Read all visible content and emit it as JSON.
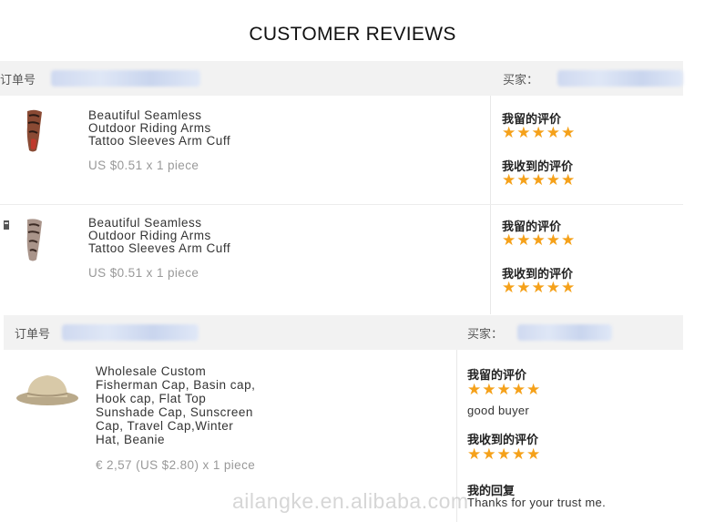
{
  "title": "CUSTOMER REVIEWS",
  "orders": [
    {
      "order_label": "订单号",
      "buyer_label": "买家：",
      "items": [
        {
          "name": "Beautiful Seamless\nOutdoor Riding Arms\nTattoo Sleeves Arm Cuff",
          "price": "US $0.51 x 1 piece",
          "my_review_label": "我留的评价",
          "my_rating": 5,
          "received_review_label": "我收到的评价",
          "received_rating": 5
        },
        {
          "name": "Beautiful Seamless\nOutdoor Riding Arms\nTattoo Sleeves Arm Cuff",
          "price": "US $0.51 x 1 piece",
          "my_review_label": "我留的评价",
          "my_rating": 5,
          "received_review_label": "我收到的评价",
          "received_rating": 5
        }
      ]
    },
    {
      "order_label": "订单号",
      "buyer_label": "买家：",
      "items": [
        {
          "name": "Wholesale Custom\nFisherman Cap, Basin cap,\nHook cap, Flat Top\nSunshade Cap, Sunscreen\nCap, Travel Cap,Winter\nHat, Beanie",
          "price": "€ 2,57 (US $2.80) x 1 piece",
          "my_review_label": "我留的评价",
          "my_rating": 5,
          "my_comment": "good buyer",
          "received_review_label": "我收到的评价",
          "received_rating": 5,
          "reply_label": "我的回复",
          "reply_text": "Thanks for your trust me."
        }
      ]
    }
  ],
  "stars_glyph": "★★★★★",
  "watermark": "ailangke.en.alibaba.com",
  "colors": {
    "star": "#f5a11a",
    "header_bg": "#f2f2f2",
    "price": "#999999"
  }
}
